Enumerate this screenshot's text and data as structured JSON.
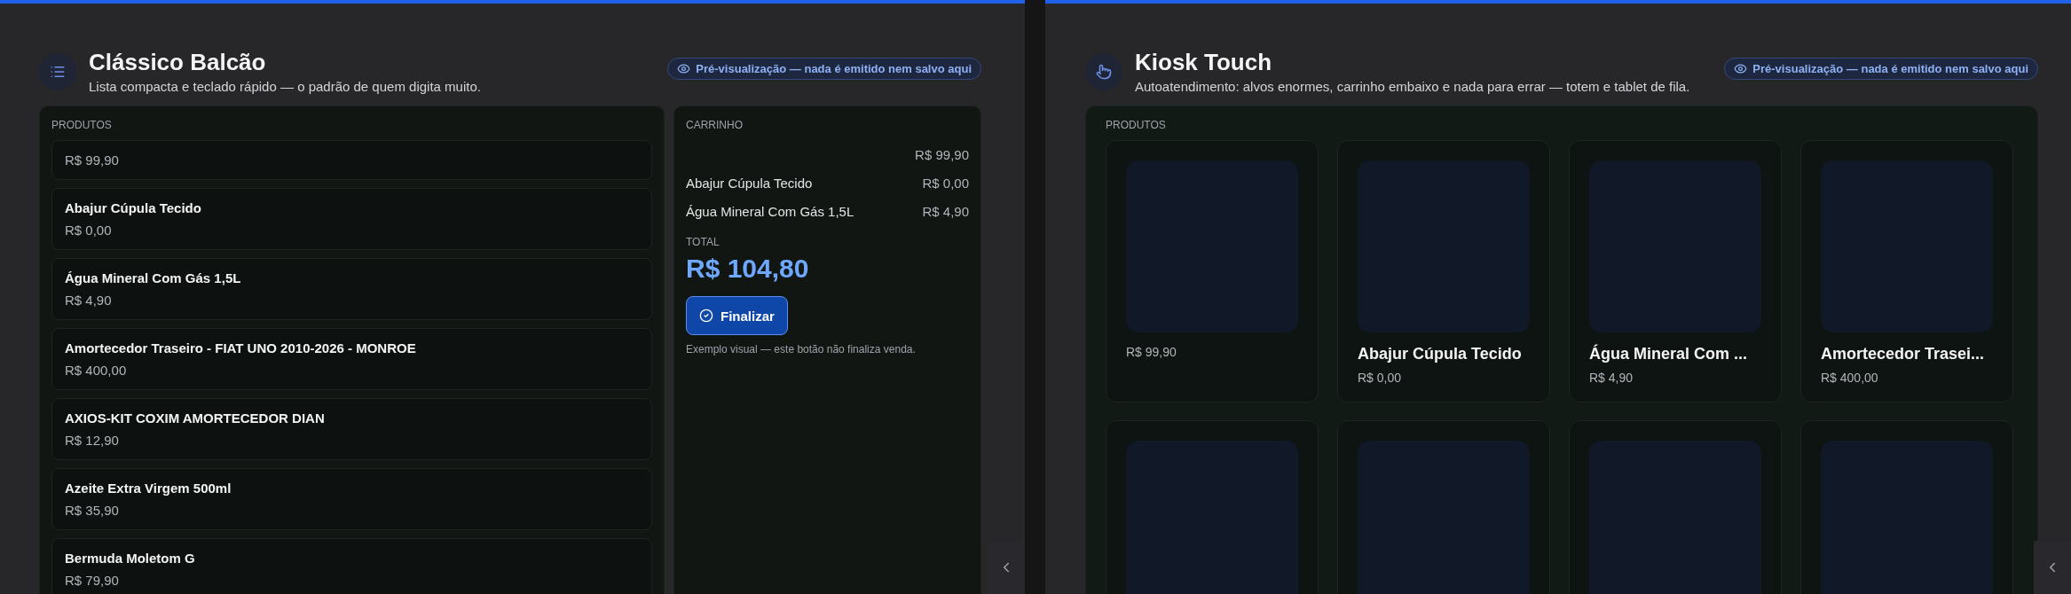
{
  "panels": [
    {
      "kind": "list",
      "title": "Clássico Balcão",
      "subtitle": "Lista compacta e teclado rápido — o padrão de quem digita muito.",
      "badge": "Pré-visualização — nada é emitido nem salvo aqui",
      "products": {
        "label": "PRODUTOS",
        "items": [
          {
            "price": "R$ 99,90"
          },
          {
            "name": "Abajur Cúpula Tecido",
            "price": "R$ 0,00"
          },
          {
            "name": "Água Mineral Com Gás 1,5L",
            "price": "R$ 4,90"
          },
          {
            "name": "Amortecedor Traseiro - FIAT UNO 2010-2026 - MONROE",
            "price": "R$ 400,00"
          },
          {
            "name": "AXIOS-KIT COXIM AMORTECEDOR DIAN",
            "price": "R$ 12,90"
          },
          {
            "name": "Azeite Extra Virgem 500ml",
            "price": "R$ 35,90"
          },
          {
            "name": "Bermuda Moletom G",
            "price": "R$ 79,90"
          }
        ]
      },
      "cart": {
        "label": "CARRINHO",
        "items": [
          {
            "price": "R$ 99,90"
          },
          {
            "name": "Abajur Cúpula Tecido",
            "price": "R$ 0,00"
          },
          {
            "name": "Água Mineral Com Gás 1,5L",
            "price": "R$ 4,90"
          }
        ],
        "total_label": "TOTAL",
        "total": "R$ 104,80",
        "button": "Finalizar",
        "note": "Exemplo visual — este botão não finaliza venda."
      }
    },
    {
      "kind": "kiosk",
      "title": "Kiosk Touch",
      "subtitle": "Autoatendimento: alvos enormes, carrinho embaixo e nada para errar — totem e tablet de fila.",
      "badge": "Pré-visualização — nada é emitido nem salvo aqui",
      "products": {
        "label": "PRODUTOS",
        "items": [
          {
            "kind": "product",
            "price": "R$ 99,90"
          },
          {
            "kind": "product",
            "name": "Abajur Cúpula Tecido",
            "price": "R$ 0,00"
          },
          {
            "kind": "product",
            "name": "Água Mineral Com ...",
            "price": "R$ 4,90"
          },
          {
            "kind": "product",
            "name": "Amortecedor Trasei...",
            "price": "R$ 400,00"
          },
          {
            "kind": "product"
          },
          {
            "kind": "product"
          },
          {
            "kind": "product"
          },
          {
            "kind": "product"
          }
        ]
      }
    }
  ]
}
